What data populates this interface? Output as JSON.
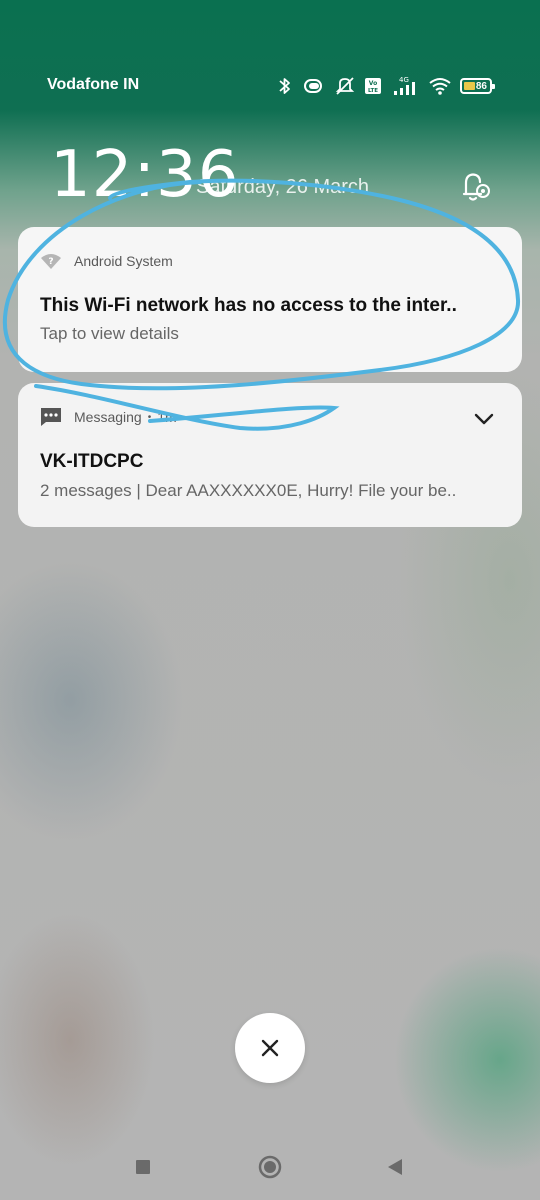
{
  "status_bar": {
    "carrier": "Vodafone IN",
    "network_type": "4G",
    "volte_label": "Vo LTE",
    "battery_level": "86",
    "battery_color": "#e9c84a",
    "icons": [
      "bluetooth-icon",
      "vibrate-ring-icon",
      "mute-icon",
      "volte-icon",
      "signal-icon",
      "wifi-icon",
      "battery-icon"
    ]
  },
  "lockscreen": {
    "time": "12:36",
    "date": "Saturday, 26 March",
    "bell_icon": "notification-settings-icon"
  },
  "notifications": [
    {
      "app": "Android System",
      "title": "This Wi-Fi network has no access to the inter..",
      "text": "Tap to view details",
      "icon": "wifi-question-icon"
    },
    {
      "app": "Messaging",
      "time_separator": "•",
      "time": "1m",
      "title": "VK-ITDCPC",
      "text": "2 messages | Dear AAXXXXXX0E, Hurry! File your be..",
      "icon": "message-icon"
    }
  ],
  "annotation_color": "#4fb3e0",
  "controls": {
    "dismiss_icon": "close-icon",
    "nav": [
      "recents-icon",
      "home-icon",
      "back-icon"
    ]
  }
}
